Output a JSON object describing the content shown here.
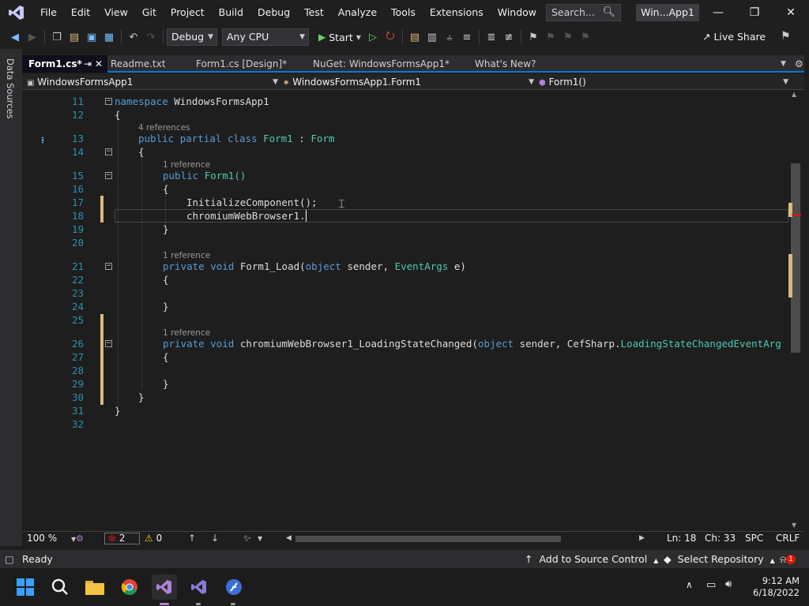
{
  "menu": {
    "items": [
      "File",
      "Edit",
      "View",
      "Git",
      "Project",
      "Build",
      "Debug",
      "Test",
      "Analyze",
      "Tools",
      "Extensions",
      "Window",
      "Help"
    ],
    "search_placeholder": "Search...",
    "solution_title": "Win...App1"
  },
  "toolbar": {
    "config": "Debug",
    "platform": "Any CPU",
    "start_label": "Start",
    "live_share": "Live Share"
  },
  "side_panel": {
    "label": "Data Sources"
  },
  "tabs": [
    {
      "label": "Form1.cs*",
      "active": true
    },
    {
      "label": "Readme.txt",
      "active": false
    },
    {
      "label": "Form1.cs [Design]*",
      "active": false
    },
    {
      "label": "NuGet: WindowsFormsApp1*",
      "active": false
    },
    {
      "label": "What's New?",
      "active": false
    }
  ],
  "navbar": {
    "project": "WindowsFormsApp1",
    "class": "WindowsFormsApp1.Form1",
    "member": "Form1()"
  },
  "code": {
    "lines": [
      "11",
      "12",
      "13",
      "14",
      "15",
      "16",
      "17",
      "18",
      "19",
      "20",
      "21",
      "22",
      "23",
      "24",
      "25",
      "26",
      "27",
      "28",
      "29",
      "30",
      "31",
      "32"
    ],
    "t_namespace": "namespace",
    "t_ns_name": "WindowsFormsApp1",
    "t_open": "{",
    "t_close": "}",
    "hint_4refs": "4 references",
    "hint_1ref": "1 reference",
    "t_public": "public",
    "t_partial": "partial",
    "t_class": "class",
    "t_form1": "Form1",
    "t_colon": ":",
    "t_form": "Form",
    "t_ctor": "Form1()",
    "t_init": "InitializeComponent();",
    "t_chromium": "chromiumWebBrowser1.",
    "t_private": "private",
    "t_void": "void",
    "t_load": "Form1_Load(",
    "t_object": "object",
    "t_sender": "sender,",
    "t_eventargs": "EventArgs",
    "t_e": "e)",
    "t_lsc": "chromiumWebBrowser1_LoadingStateChanged(",
    "t_cefsharp": "CefSharp.",
    "t_lsc_args": "LoadingStateChangedEventArg"
  },
  "status_row": {
    "zoom": "100 %",
    "errors": "2",
    "warnings": "0",
    "ln": "Ln: 18",
    "ch": "Ch: 33",
    "spc": "SPC",
    "crlf": "CRLF"
  },
  "statusbar": {
    "ready": "Ready",
    "source_control": "Add to Source Control",
    "repository": "Select Repository",
    "notifications": "1"
  },
  "taskbar": {
    "time": "9:12 AM",
    "date": "6/18/2022"
  },
  "colors": {
    "accent": "#0078d4",
    "keyword": "#569cd6",
    "type": "#4ec9b0",
    "line_number": "#2b91af",
    "error": "#e51400"
  }
}
